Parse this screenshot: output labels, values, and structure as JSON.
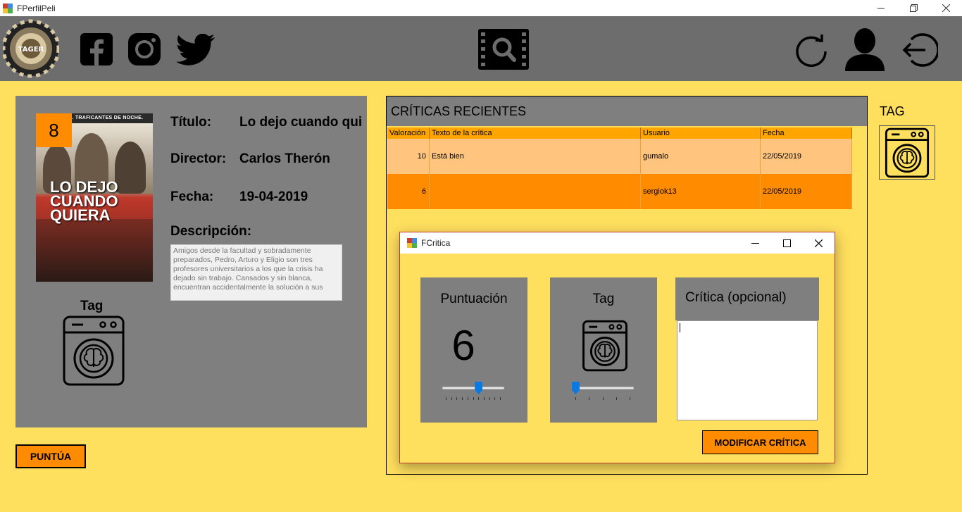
{
  "window": {
    "title": "FPerfilPeli"
  },
  "toolbar": {
    "logo_text": "TAGER",
    "icons": [
      "facebook-icon",
      "instagram-icon",
      "twitter-icon",
      "film-search-icon",
      "refresh-icon",
      "user-icon",
      "logout-icon"
    ]
  },
  "movie": {
    "score": "8",
    "poster_tagline": "ES DE DÍA. TRAFICANTES DE NOCHE.",
    "poster_title": "LO DEJO CUANDO QUIERA",
    "title_label": "Título:",
    "title_value": "Lo dejo cuando qui",
    "director_label": "Director:",
    "director_value": "Carlos Therón",
    "date_label": "Fecha:",
    "date_value": "19-04-2019",
    "description_label": "Descripción:",
    "description": "Amigos desde la facultad y sobradamente preparados, Pedro, Arturo y Eligio son tres profesores universitarios a los que la crisis ha dejado sin trabajo. Cansados y sin blanca, encuentran accidentalmente la solución a sus",
    "tag_label": "Tag"
  },
  "buttons": {
    "rate": "PUNTÚA",
    "modify": "MODIFICAR CRÍTICA"
  },
  "reviews": {
    "header": "CRÍTICAS RECIENTES",
    "columns": [
      "Valoración",
      "Texto de la crítica",
      "Usuario",
      "Fecha"
    ],
    "rows": [
      {
        "rating": "10",
        "text": "Está bien",
        "user": "gumalo",
        "date": "22/05/2019"
      },
      {
        "rating": "6",
        "text": "",
        "user": "sergiok13",
        "date": "22/05/2019"
      }
    ]
  },
  "side_tag": {
    "label": "TAG"
  },
  "dialog": {
    "title": "FCritica",
    "score_label": "Puntuación",
    "score_value": "6",
    "score_slider": {
      "min": 0,
      "max": 10,
      "value": 6
    },
    "tag_label": "Tag",
    "tag_slider": {
      "min": 0,
      "max": 4,
      "value": 0
    },
    "review_label": "Crítica (opcional)",
    "review_text": ""
  },
  "colors": {
    "accent": "#ff8c00",
    "background": "#ffdf5e",
    "panel": "#7f7f7f",
    "toolbar": "#6d6d6d"
  }
}
